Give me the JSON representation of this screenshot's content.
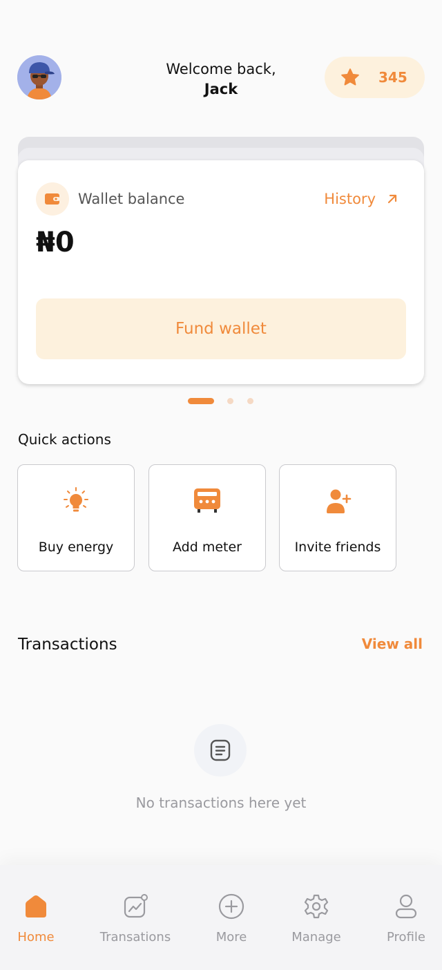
{
  "header": {
    "greeting": "Welcome back,",
    "user_name": "Jack",
    "points": "345"
  },
  "wallet": {
    "label": "Wallet balance",
    "history_label": "History",
    "balance": "₦0",
    "fund_button": "Fund wallet",
    "carousel_pages": 3,
    "carousel_active": 1
  },
  "quick_actions": {
    "title": "Quick actions",
    "items": [
      {
        "label": "Buy energy",
        "icon": "lightbulb-icon"
      },
      {
        "label": "Add meter",
        "icon": "meter-icon"
      },
      {
        "label": "Invite friends",
        "icon": "add-user-icon"
      }
    ]
  },
  "transactions": {
    "title": "Transactions",
    "view_all": "View all",
    "empty_text": "No transactions here yet"
  },
  "bottom_nav": {
    "items": [
      {
        "label": "Home",
        "icon": "home-icon",
        "active": true
      },
      {
        "label": "Transations",
        "icon": "chart-icon",
        "active": false
      },
      {
        "label": "More",
        "icon": "plus-circle-icon",
        "active": false
      },
      {
        "label": "Manage",
        "icon": "gear-icon",
        "active": false
      },
      {
        "label": "Profile",
        "icon": "user-icon",
        "active": false
      }
    ]
  },
  "colors": {
    "accent": "#f08a3b",
    "accent_light": "#fdf1dd",
    "muted": "#9a9a9f",
    "background": "#fafafa"
  }
}
